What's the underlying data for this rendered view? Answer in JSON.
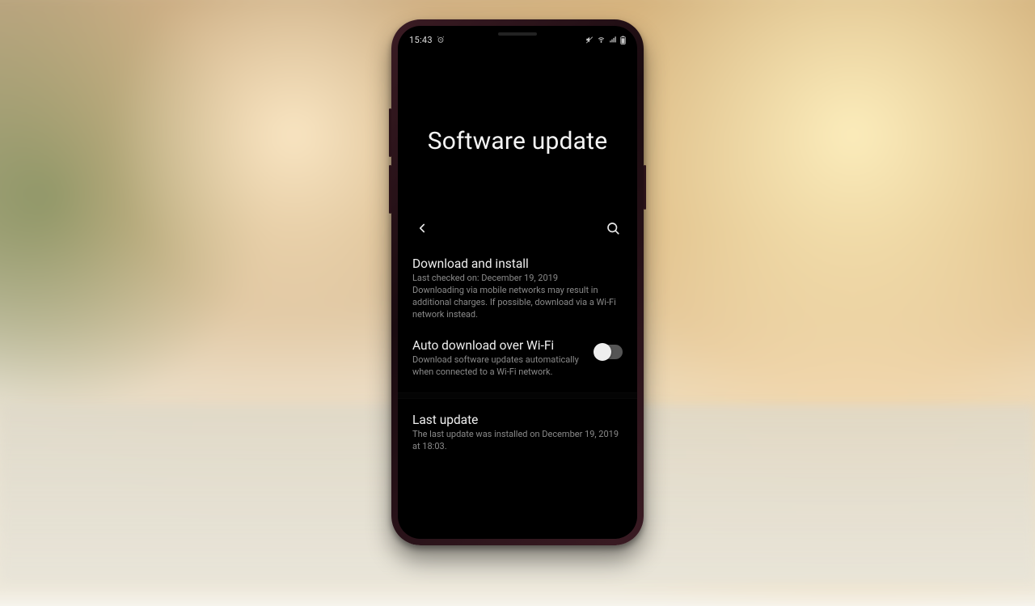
{
  "status": {
    "time": "15:43"
  },
  "header": {
    "title": "Software update"
  },
  "items": {
    "download": {
      "title": "Download and install",
      "desc": "Last checked on: December 19, 2019\nDownloading via mobile networks may result in additional charges. If possible, download via a Wi-Fi network instead."
    },
    "auto": {
      "title": "Auto download over Wi-Fi",
      "desc": "Download software updates automatically when connected to a Wi-Fi network.",
      "toggle": false
    },
    "last": {
      "title": "Last update",
      "desc": "The last update was installed on December 19, 2019 at 18:03."
    }
  }
}
